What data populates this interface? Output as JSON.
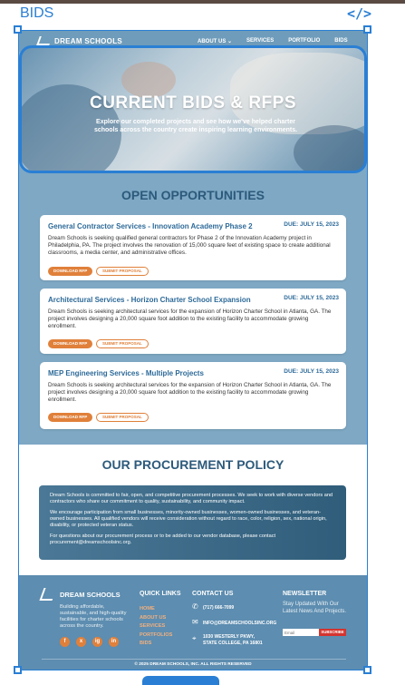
{
  "editor": {
    "label": "BIDS",
    "code_icon": "</>"
  },
  "nav": {
    "brand": "DREAM SCHOOLS",
    "links": [
      "ABOUT US ⌄",
      "SERVICES",
      "PORTFOLIO",
      "BIDS"
    ]
  },
  "hero": {
    "title": "CURRENT BIDS & RFPS",
    "subtitle": "Explore our completed projects and see how we've helped charter schools across the country create inspiring learning environments."
  },
  "opportunities": {
    "title": "OPEN OPPORTUNITIES",
    "cards": [
      {
        "title": "General Contractor Services - Innovation Academy Phase 2",
        "due": "DUE: JULY 15, 2023",
        "desc": "Dream Schools is seeking qualified general contractors for Phase 2 of the Innovation Academy project in Philadelphia, PA. The project involves the renovation of 15,000 square feet of existing space to create additional classrooms, a media center, and administrative offices.",
        "download": "DOWNLOAD RFP",
        "submit": "SUBMIT PROPOSAL"
      },
      {
        "title": "Architectural Services - Horizon Charter School Expansion",
        "due": "DUE: JULY 15, 2023",
        "desc": "Dream Schools is seeking architectural services for the expansion of Horizon Charter School in Atlanta, GA. The project involves designing a 20,000 square foot addition to the existing facility to accommodate growing enrollment.",
        "download": "DOWNLOAD RFP",
        "submit": "SUBMIT PROPOSAL"
      },
      {
        "title": "MEP Engineering Services - Multiple Projects",
        "due": "DUE: JULY 15, 2023",
        "desc": "Dream Schools is seeking architectural services for the expansion of Horizon Charter School in Atlanta, GA. The project involves designing a 20,000 square foot addition to the existing facility to accommodate growing enrollment.",
        "download": "DOWNLOAD RFP",
        "submit": "SUBMIT PROPOSAL"
      }
    ]
  },
  "policy": {
    "title": "OUR PROCUREMENT POLICY",
    "paragraphs": [
      "Dream Schools is committed to fair, open, and competitive procurement processes. We seek to work with diverse vendors and contractors who share our commitment to quality, sustainability, and community impact.",
      "We encourage participation from small businesses, minority-owned businesses, women-owned businesses, and veteran-owned businesses. All qualified vendors will receive consideration without regard to race, color, religion, sex, national origin, disability, or protected veteran status.",
      "For questions about our procurement process or to be added to our vendor database, please contact procurement@dreamschoolsinc.org."
    ]
  },
  "footer": {
    "brand": "DREAM SCHOOLS",
    "about": "Building affordable, sustainable, and high-quality facilities for charter schools across the country.",
    "socials": [
      "f",
      "x",
      "ig",
      "in"
    ],
    "quick_links_title": "QUICK LINKS",
    "quick_links": [
      "HOME",
      "ABOUT US",
      "SERVICES",
      "PORTFOLIOS",
      "BIDS"
    ],
    "contact_title": "CONTACT US",
    "phone": "(717) 666-7099",
    "email": "INFO@DREAMSCHOOLSINC.ORG",
    "address_line1": "1030 WESTERLY PKWY,",
    "address_line2": "STATE COLLEGE, PA 16801",
    "newsletter_title": "NEWSLETTER",
    "newsletter_text": "Stay Updated With Our Latest News And Projects.",
    "email_placeholder": "Email",
    "subscribe": "SUBSCRIBE",
    "copyright": "© 2025 DREAM SCHOOLS, INC. ALL RIGHTS RESERVED"
  },
  "colors": {
    "accent": "#e0803a",
    "brand_blue": "#2d5a7b",
    "selection": "#2a7fd4",
    "subscribe": "#d4342f"
  }
}
